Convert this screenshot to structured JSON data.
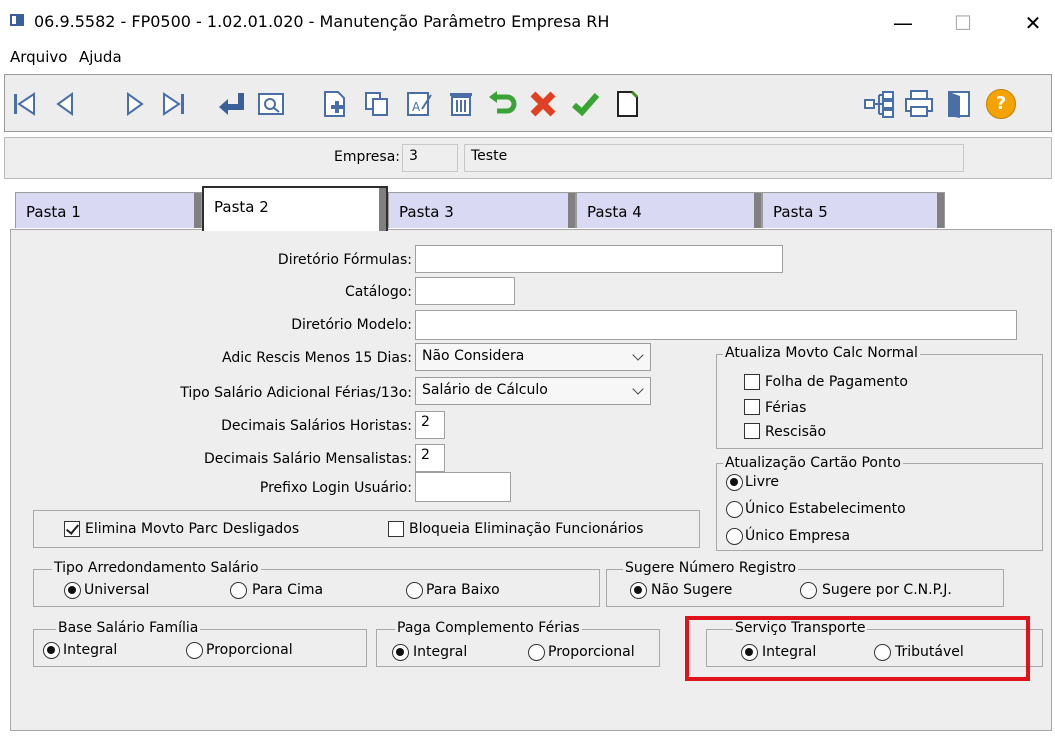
{
  "window": {
    "title": "06.9.5582 - FP0500 - 1.02.01.020 - Manutenção Parâmetro Empresa RH",
    "minimize_symbol": "—",
    "maximize_symbol": "☐",
    "close_symbol": "✕"
  },
  "menu": [
    "Arquivo",
    "Ajuda"
  ],
  "toolbar": {
    "left": [
      "first-record-icon",
      "previous-record-icon",
      "next-record-icon",
      "last-record-icon",
      "return-icon",
      "zoom-icon",
      "new-record-icon",
      "copy-record-icon",
      "edit-record-icon",
      "delete-record-icon",
      "undo-icon",
      "cancel-icon",
      "confirm-icon",
      "new-document-icon"
    ],
    "right": [
      "hierarchy-icon",
      "print-icon",
      "exit-door-icon",
      "help-icon"
    ],
    "help_symbol": "?"
  },
  "header": {
    "empresa_label": "Empresa:",
    "empresa_code": "3",
    "empresa_name": "Teste"
  },
  "tabs": [
    "Pasta 1",
    "Pasta 2",
    "Pasta 3",
    "Pasta 4",
    "Pasta 5"
  ],
  "active_tab": "Pasta 2",
  "form": {
    "diretorio_formulas_label": "Diretório Fórmulas:",
    "diretorio_formulas_value": "",
    "catalogo_label": "Catálogo:",
    "catalogo_value": "",
    "diretorio_modelo_label": "Diretório Modelo:",
    "diretorio_modelo_value": "",
    "adic_rescis_label": "Adic Rescis Menos 15 Dias:",
    "adic_rescis_value": "Não Considera",
    "tipo_salario_label": "Tipo Salário Adicional Férias/13o:",
    "tipo_salario_value": "Salário de Cálculo",
    "dec_horistas_label": "Decimais Salários Horistas:",
    "dec_horistas_value": "2",
    "dec_mensalistas_label": "Decimais Salário Mensalistas:",
    "dec_mensalistas_value": "2",
    "prefixo_login_label": "Prefixo Login Usuário:",
    "prefixo_login_value": ""
  },
  "atualiza_movto": {
    "legend": "Atualiza Movto Calc Normal",
    "options": [
      {
        "label": "Folha de Pagamento",
        "checked": false
      },
      {
        "label": "Férias",
        "checked": false
      },
      {
        "label": "Rescisão",
        "checked": false
      }
    ]
  },
  "atualizacao_cartao": {
    "legend": "Atualização Cartão Ponto",
    "options": [
      "Livre",
      "Único Estabelecimento",
      "Único Empresa"
    ],
    "selected": "Livre"
  },
  "checks": {
    "elimina_movto": {
      "label": "Elimina Movto Parc Desligados",
      "checked": true
    },
    "bloqueia_elim": {
      "label": "Bloqueia Eliminação Funcionários",
      "checked": false
    }
  },
  "tipo_arredondamento": {
    "legend": "Tipo Arredondamento Salário",
    "options": [
      "Universal",
      "Para Cima",
      "Para Baixo"
    ],
    "selected": "Universal"
  },
  "sugere_numero": {
    "legend": "Sugere Número Registro",
    "options": [
      "Não Sugere",
      "Sugere por C.N.P.J."
    ],
    "selected": "Não Sugere"
  },
  "base_salario_familia": {
    "legend": "Base Salário Família",
    "options": [
      "Integral",
      "Proporcional"
    ],
    "selected": "Integral"
  },
  "paga_complemento": {
    "legend": "Paga Complemento Férias",
    "options": [
      "Integral",
      "Proporcional"
    ],
    "selected": "Integral"
  },
  "servico_transporte": {
    "legend": "Serviço Transporte",
    "options": [
      "Integral",
      "Tributável"
    ],
    "selected": "Integral"
  },
  "colors": {
    "highlight": "#e0121c",
    "tab_inactive": "#d9d9f3",
    "panel": "#eeeeee",
    "toolbar_blue": "#4a6fa8",
    "help_orange": "#f5a300"
  }
}
